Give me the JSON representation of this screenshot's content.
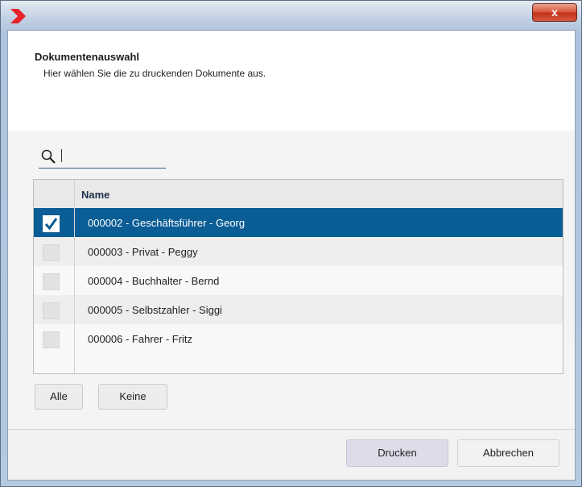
{
  "window": {
    "close_label": "x"
  },
  "dialog": {
    "title": "Dokumentenauswahl",
    "subtitle": "Hier wählen Sie die zu druckenden Dokumente aus."
  },
  "search": {
    "value": "",
    "placeholder": ""
  },
  "table": {
    "columns": [
      "Name"
    ],
    "rows": [
      {
        "label": "000002 - Geschäftsführer - Georg",
        "checked": true,
        "selected": true
      },
      {
        "label": "000003 - Privat - Peggy",
        "checked": false,
        "selected": false
      },
      {
        "label": "000004 - Buchhalter - Bernd",
        "checked": false,
        "selected": false
      },
      {
        "label": "000005 - Selbstzahler - Siggi",
        "checked": false,
        "selected": false
      },
      {
        "label": "000006 - Fahrer - Fritz",
        "checked": false,
        "selected": false
      }
    ]
  },
  "selection_buttons": {
    "all": "Alle",
    "none": "Keine"
  },
  "footer": {
    "print": "Drucken",
    "cancel": "Abbrechen"
  },
  "colors": {
    "selection": "#0b5d95",
    "logo": "#e8222a",
    "close": "#c8351b"
  }
}
